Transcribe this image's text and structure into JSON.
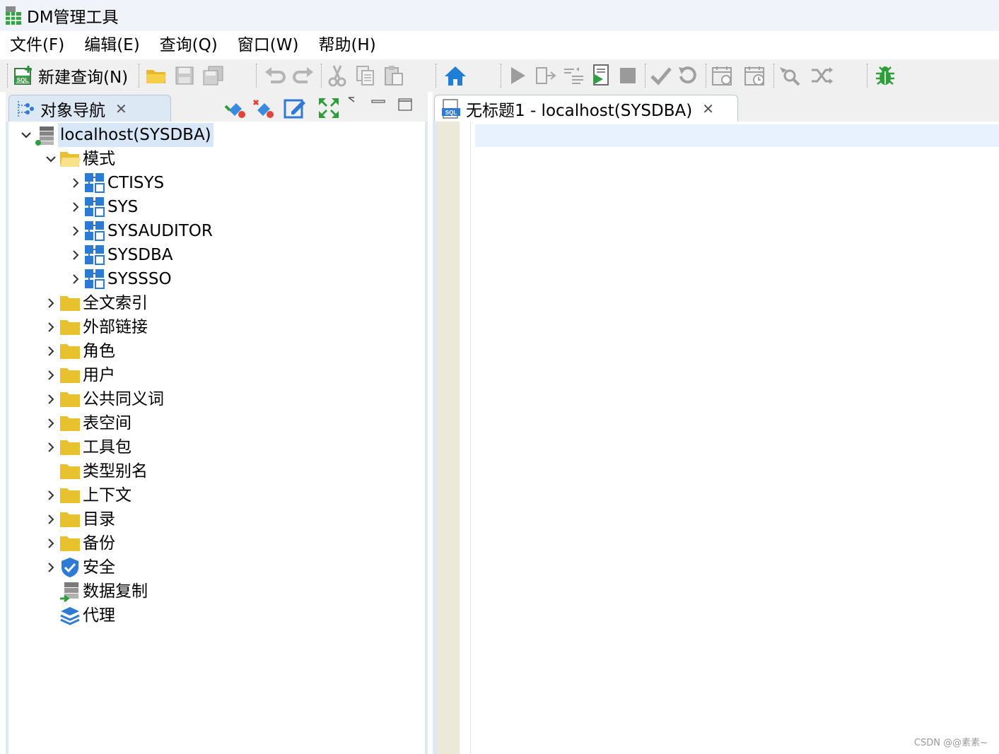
{
  "window": {
    "title": "DM管理工具"
  },
  "menu": [
    "文件(F)",
    "编辑(E)",
    "查询(Q)",
    "窗口(W)",
    "帮助(H)"
  ],
  "toolbar": {
    "new_query_label": "新建查询(N)",
    "icons": [
      "new-query-icon",
      "open-folder-icon",
      "save-icon",
      "save-all-icon",
      "undo-icon",
      "redo-icon",
      "cut-icon",
      "copy-icon",
      "paste-icon",
      "home-icon",
      "run-icon",
      "run-step-icon",
      "explain-icon",
      "run-script-icon",
      "stop-icon",
      "commit-icon",
      "rollback-icon",
      "schedule-icon",
      "schedule-history-icon",
      "search-icon",
      "export-icon",
      "debug-icon"
    ]
  },
  "left_panel": {
    "tab_label": "对象导航",
    "tab_close": "✕",
    "tree": [
      {
        "label": "localhost(SYSDBA)",
        "level": 0,
        "expanded": true,
        "icon": "database-icon",
        "selected": true
      },
      {
        "label": "模式",
        "level": 1,
        "expanded": true,
        "icon": "folder-open-icon"
      },
      {
        "label": "CTISYS",
        "level": 2,
        "expanded": false,
        "icon": "schema-icon"
      },
      {
        "label": "SYS",
        "level": 2,
        "expanded": false,
        "icon": "schema-icon"
      },
      {
        "label": "SYSAUDITOR",
        "level": 2,
        "expanded": false,
        "icon": "schema-icon"
      },
      {
        "label": "SYSDBA",
        "level": 2,
        "expanded": false,
        "icon": "schema-icon"
      },
      {
        "label": "SYSSSO",
        "level": 2,
        "expanded": false,
        "icon": "schema-icon"
      },
      {
        "label": "全文索引",
        "level": 1,
        "expanded": false,
        "icon": "folder-icon"
      },
      {
        "label": "外部链接",
        "level": 1,
        "expanded": false,
        "icon": "folder-icon"
      },
      {
        "label": "角色",
        "level": 1,
        "expanded": false,
        "icon": "folder-icon"
      },
      {
        "label": "用户",
        "level": 1,
        "expanded": false,
        "icon": "folder-icon"
      },
      {
        "label": "公共同义词",
        "level": 1,
        "expanded": false,
        "icon": "folder-icon"
      },
      {
        "label": "表空间",
        "level": 1,
        "expanded": false,
        "icon": "folder-icon"
      },
      {
        "label": "工具包",
        "level": 1,
        "expanded": false,
        "icon": "folder-icon"
      },
      {
        "label": "类型别名",
        "level": 1,
        "expanded": null,
        "icon": "folder-icon"
      },
      {
        "label": "上下文",
        "level": 1,
        "expanded": false,
        "icon": "folder-icon"
      },
      {
        "label": "目录",
        "level": 1,
        "expanded": false,
        "icon": "folder-icon"
      },
      {
        "label": "备份",
        "level": 1,
        "expanded": false,
        "icon": "folder-icon"
      },
      {
        "label": "安全",
        "level": 1,
        "expanded": false,
        "icon": "shield-icon"
      },
      {
        "label": "数据复制",
        "level": 1,
        "expanded": null,
        "icon": "replication-icon"
      },
      {
        "label": "代理",
        "level": 1,
        "expanded": null,
        "icon": "agent-icon"
      }
    ]
  },
  "editor_tab": {
    "label": "无标题1 - localhost(SYSDBA)",
    "close": "✕"
  },
  "watermark": "CSDN @@素素~",
  "colors": {
    "folder": "#e8c22e",
    "schema_blue": "#2b7bd4",
    "selection": "#d7e7f7",
    "gutter": "#ece9d8",
    "current_line": "#e8f2fe"
  }
}
